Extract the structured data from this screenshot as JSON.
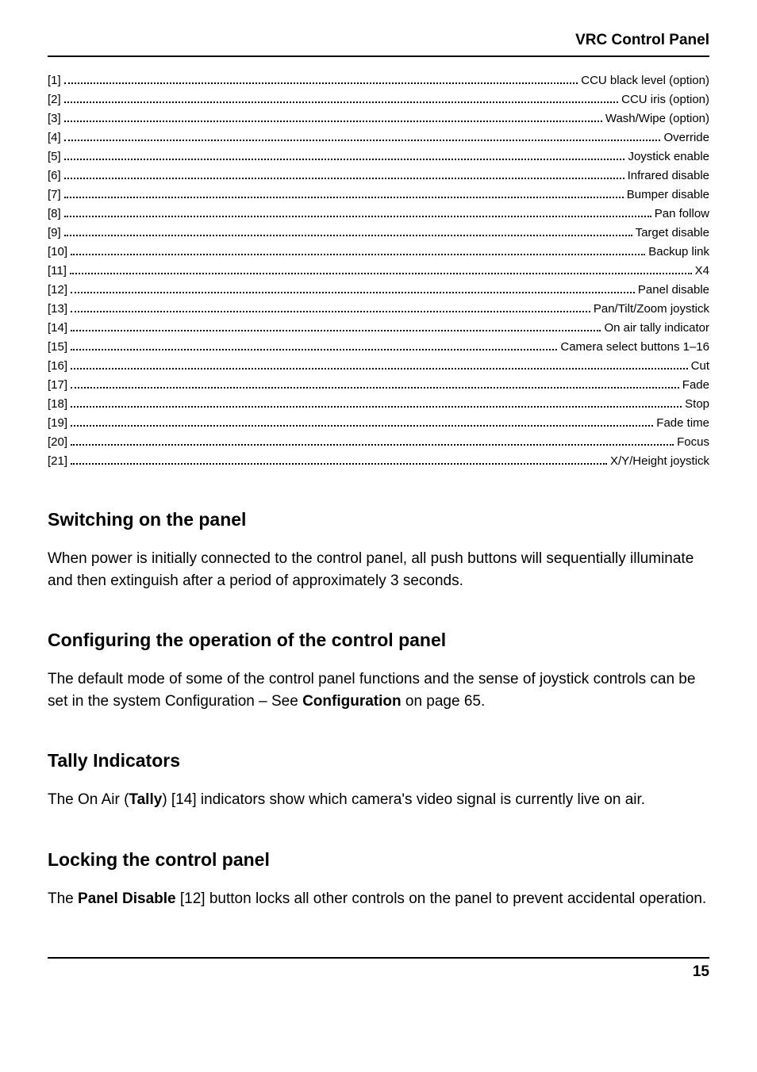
{
  "header": {
    "title": "VRC Control Panel"
  },
  "toc": [
    {
      "num": "[1]",
      "label": "CCU black level (option)"
    },
    {
      "num": "[2]",
      "label": "CCU iris (option)"
    },
    {
      "num": "[3]",
      "label": "Wash/Wipe (option)"
    },
    {
      "num": "[4]",
      "label": "Override"
    },
    {
      "num": "[5]",
      "label": "Joystick enable"
    },
    {
      "num": "[6]",
      "label": "Infrared disable"
    },
    {
      "num": "[7]",
      "label": "Bumper disable"
    },
    {
      "num": "[8]",
      "label": "Pan follow"
    },
    {
      "num": "[9]",
      "label": "Target disable"
    },
    {
      "num": "[10]",
      "label": "Backup link"
    },
    {
      "num": "[11]",
      "label": "X4"
    },
    {
      "num": "[12]",
      "label": "Panel disable"
    },
    {
      "num": "[13]",
      "label": "Pan/Tilt/Zoom joystick"
    },
    {
      "num": "[14]",
      "label": "On air tally indicator"
    },
    {
      "num": "[15]",
      "label": "Camera select buttons 1–16"
    },
    {
      "num": "[16]",
      "label": "Cut"
    },
    {
      "num": "[17]",
      "label": "Fade"
    },
    {
      "num": "[18]",
      "label": "Stop"
    },
    {
      "num": "[19]",
      "label": "Fade time"
    },
    {
      "num": "[20]",
      "label": "Focus"
    },
    {
      "num": "[21]",
      "label": "X/Y/Height joystick"
    }
  ],
  "sections": {
    "switching": {
      "heading": "Switching on the panel",
      "body": "When power is initially connected to the control panel, all push buttons will sequentially illuminate and then extinguish after a period of approximately 3 seconds."
    },
    "configuring": {
      "heading": "Configuring the operation of the control panel",
      "body_pre": "The default mode of some of the control panel functions and the sense of joystick controls can be set in the system Configuration – See ",
      "body_bold": "Configuration",
      "body_post": " on page 65."
    },
    "tally": {
      "heading": "Tally Indicators",
      "body_pre": "The On Air (",
      "body_bold": "Tally",
      "body_post": ") [14] indicators show which camera's video signal is currently live on air."
    },
    "locking": {
      "heading": "Locking the control panel",
      "body_pre": "The ",
      "body_bold": "Panel Disable",
      "body_post": " [12] button locks all other controls on the panel to prevent accidental operation."
    }
  },
  "footer": {
    "page": "15"
  }
}
